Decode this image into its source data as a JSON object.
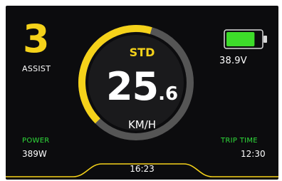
{
  "assist": {
    "level": "3",
    "label": "ASSIST"
  },
  "battery": {
    "voltage": "38.9V",
    "charge_fraction": 0.82,
    "color": "#3ddc2a"
  },
  "speed": {
    "mode": "STD",
    "integer": "25",
    "decimal": ".6",
    "unit": "KM/H",
    "gauge_fraction": 0.42
  },
  "power": {
    "label": "POWER",
    "value": "389W"
  },
  "trip": {
    "label": "TRIP TIME",
    "value": "12:30"
  },
  "clock": {
    "time": "16:23"
  },
  "colors": {
    "accent": "#f5d21a",
    "status_green": "#2fdc3a",
    "background": "#0c0c0e",
    "ring_track": "#555555"
  }
}
